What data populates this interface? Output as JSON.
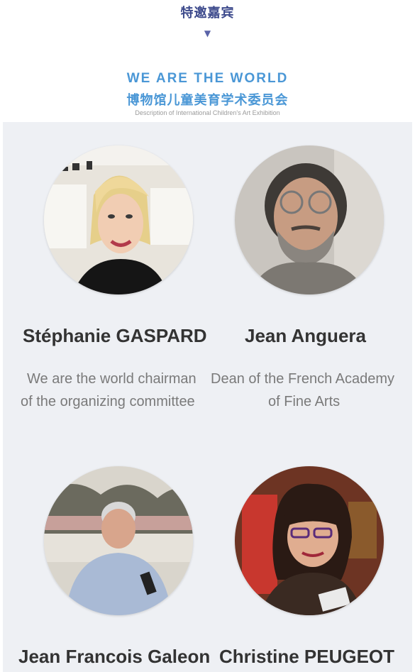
{
  "header": {
    "title": "特邀嘉宾",
    "arrow": "▼",
    "eng_title": "WE ARE THE WORLD",
    "cn_title": "博物馆儿童美育学术委员会",
    "subtitle": "Description of International Children's Art Exhibition"
  },
  "guests": [
    {
      "name": "Stéphanie GASPARD",
      "role_line1": "We are the world chairman",
      "role_line2": "of the organizing committee"
    },
    {
      "name": "Jean Anguera",
      "role_line1": "Dean of the French Academy",
      "role_line2": "of Fine Arts"
    },
    {
      "name": "Jean Francois Galeon",
      "role_line1": "",
      "role_line2": ""
    },
    {
      "name": "Christine PEUGEOT",
      "role_line1": "",
      "role_line2": ""
    }
  ],
  "colors": {
    "heading": "#3d4a8c",
    "accent": "#4a97d6",
    "panel": "#eef0f4"
  }
}
